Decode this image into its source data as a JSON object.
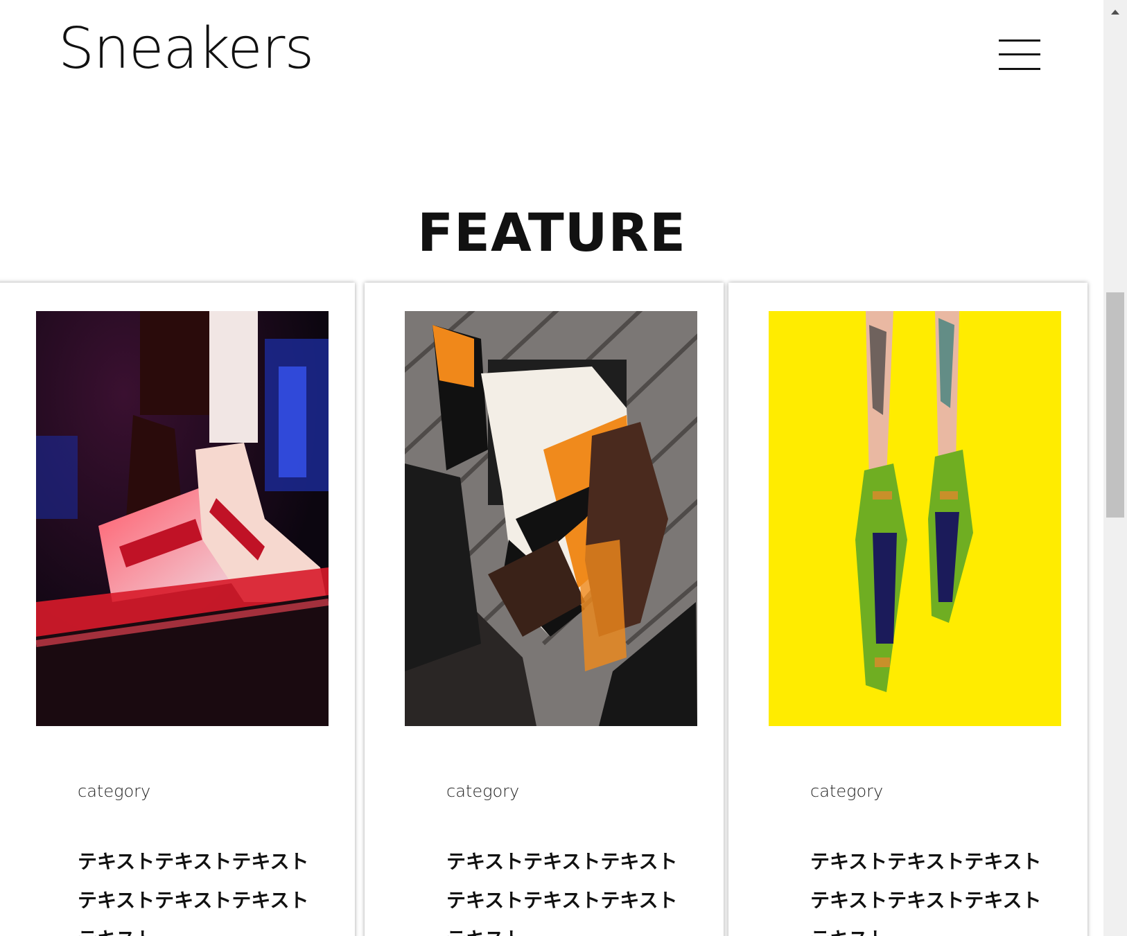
{
  "header": {
    "logo": "Sneakers",
    "menu_icon": "hamburger-menu-icon"
  },
  "section": {
    "title": "FEATURE"
  },
  "cards": [
    {
      "category": "category",
      "text": "テキストテキストテキストテキストテキストテキストテキスト",
      "image": "reebok-sneakers-on-stage-photo",
      "image_colors": {
        "bg": "#1a0d18",
        "accent": "#e83a4a"
      }
    },
    {
      "category": "category",
      "text": "テキストテキストテキストテキストテキストテキストテキスト",
      "image": "nike-orange-sneaker-in-hands-photo",
      "image_colors": {
        "bg": "#6e6a68",
        "accent": "#f08a1c"
      }
    },
    {
      "category": "category",
      "text": "テキストテキストテキストテキストテキストテキストテキスト",
      "image": "green-sneakers-on-yellow-photo",
      "image_colors": {
        "bg": "#ffe900",
        "accent": "#6fae22"
      }
    }
  ],
  "colors": {
    "text": "#111111",
    "background": "#ffffff",
    "scrollbar_track": "#f0f0f0",
    "scrollbar_thumb": "#c1c1c1"
  }
}
